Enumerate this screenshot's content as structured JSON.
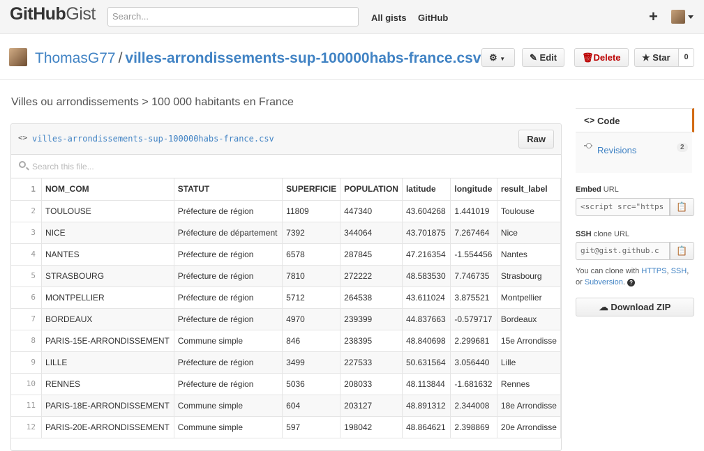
{
  "header": {
    "logo_bold": "GitHub",
    "logo_light": "Gist",
    "search_placeholder": "Search...",
    "all_gists": "All gists",
    "github": "GitHub",
    "new_icon": "plus-icon"
  },
  "gist": {
    "owner": "ThomasG77",
    "separator": "/",
    "filename": "villes-arrondissements-sup-100000habs-france.csv",
    "description": "Villes ou arrondissements > 100 000 habitants en France",
    "actions": {
      "edit": "Edit",
      "delete": "Delete",
      "star": "Star",
      "star_count": "0"
    }
  },
  "file": {
    "name": "villes-arrondissements-sup-100000habs-france.csv",
    "raw": "Raw",
    "search_placeholder": "Search this file...",
    "rows": [
      [
        "1",
        "NOM_COM",
        "STATUT",
        "SUPERFICIE",
        "POPULATION",
        "latitude",
        "longitude",
        "result_label"
      ],
      [
        "2",
        "TOULOUSE",
        "Préfecture de région",
        "11809",
        "447340",
        "43.604268",
        "1.441019",
        "Toulouse"
      ],
      [
        "3",
        "NICE",
        "Préfecture de département",
        "7392",
        "344064",
        "43.701875",
        "7.267464",
        "Nice"
      ],
      [
        "4",
        "NANTES",
        "Préfecture de région",
        "6578",
        "287845",
        "47.216354",
        "-1.554456",
        "Nantes"
      ],
      [
        "5",
        "STRASBOURG",
        "Préfecture de région",
        "7810",
        "272222",
        "48.583530",
        "7.746735",
        "Strasbourg"
      ],
      [
        "6",
        "MONTPELLIER",
        "Préfecture de région",
        "5712",
        "264538",
        "43.611024",
        "3.875521",
        "Montpellier"
      ],
      [
        "7",
        "BORDEAUX",
        "Préfecture de région",
        "4970",
        "239399",
        "44.837663",
        "-0.579717",
        "Bordeaux"
      ],
      [
        "8",
        "PARIS-15E-ARRONDISSEMENT",
        "Commune simple",
        "846",
        "238395",
        "48.840698",
        "2.299681",
        "15e Arrondisse"
      ],
      [
        "9",
        "LILLE",
        "Préfecture de région",
        "3499",
        "227533",
        "50.631564",
        "3.056440",
        "Lille"
      ],
      [
        "10",
        "RENNES",
        "Préfecture de région",
        "5036",
        "208033",
        "48.113844",
        "-1.681632",
        "Rennes"
      ],
      [
        "11",
        "PARIS-18E-ARRONDISSEMENT",
        "Commune simple",
        "604",
        "203127",
        "48.891312",
        "2.344008",
        "18e Arrondisse"
      ],
      [
        "12",
        "PARIS-20E-ARRONDISSEMENT",
        "Commune simple",
        "597",
        "198042",
        "48.864621",
        "2.398869",
        "20e Arrondisse"
      ]
    ]
  },
  "sidebar": {
    "code": "Code",
    "revisions": "Revisions",
    "revisions_count": "2",
    "embed_label": "Embed",
    "embed_suffix": "URL",
    "embed_value": "<script src=\"https",
    "ssh_label": "SSH",
    "ssh_suffix": "clone URL",
    "ssh_value": "git@gist.github.c",
    "help_prefix": "You can clone with",
    "https": "HTTPS",
    "ssh": "SSH",
    "or": "or",
    "subversion": "Subversion",
    "download": "Download ZIP"
  },
  "colors": {
    "link": "#4183c4",
    "delete": "#bb0000",
    "active_tab": "#d26911"
  }
}
